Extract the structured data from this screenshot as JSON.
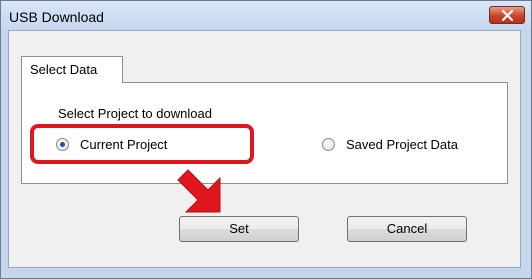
{
  "window": {
    "title": "USB Download"
  },
  "tabs": [
    {
      "label": "Select Data",
      "active": true
    }
  ],
  "panel": {
    "group_label": "Select Project to download",
    "options": [
      {
        "label": "Current Project",
        "checked": true,
        "highlighted": true
      },
      {
        "label": "Saved Project Data",
        "checked": false
      }
    ]
  },
  "buttons": {
    "set_label": "Set",
    "cancel_label": "Cancel"
  },
  "annotations": {
    "highlight_color": "#e0161f",
    "arrow_color": "#e0161f",
    "arrow_points_to": "Set"
  },
  "colors": {
    "titlebar": "#c4d6ef",
    "close_button": "#c8442a",
    "radio_dot": "#1f4fa6"
  }
}
